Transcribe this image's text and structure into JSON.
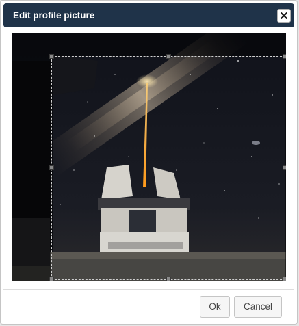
{
  "dialog": {
    "title": "Edit profile picture",
    "close_icon": "close-icon"
  },
  "image": {
    "description_icon": "photo-image"
  },
  "buttons": {
    "ok_label": "Ok",
    "cancel_label": "Cancel"
  },
  "colors": {
    "titlebar": "#1f3349",
    "dialog_bg": "#ffffff",
    "button_bg": "#f6f6f6"
  }
}
